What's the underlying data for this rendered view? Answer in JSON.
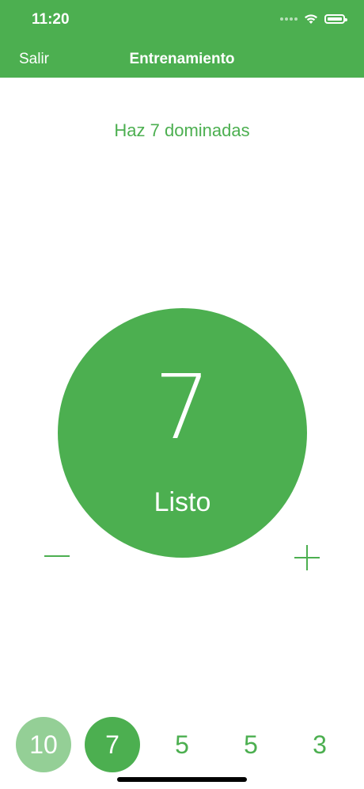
{
  "status_bar": {
    "time": "11:20"
  },
  "nav": {
    "back_label": "Salir",
    "title": "Entrenamiento"
  },
  "instruction": "Haz 7 dominadas",
  "counter": {
    "value": "7",
    "done_label": "Listo"
  },
  "controls": {
    "decrement_icon": "minus-icon",
    "increment_icon": "plus-icon"
  },
  "sets": [
    {
      "value": "10",
      "state": "completed"
    },
    {
      "value": "7",
      "state": "current"
    },
    {
      "value": "5",
      "state": "pending"
    },
    {
      "value": "5",
      "state": "pending"
    },
    {
      "value": "3",
      "state": "pending"
    }
  ],
  "colors": {
    "accent": "#4caf50",
    "completed": "#94cf96",
    "background": "#ffffff"
  }
}
